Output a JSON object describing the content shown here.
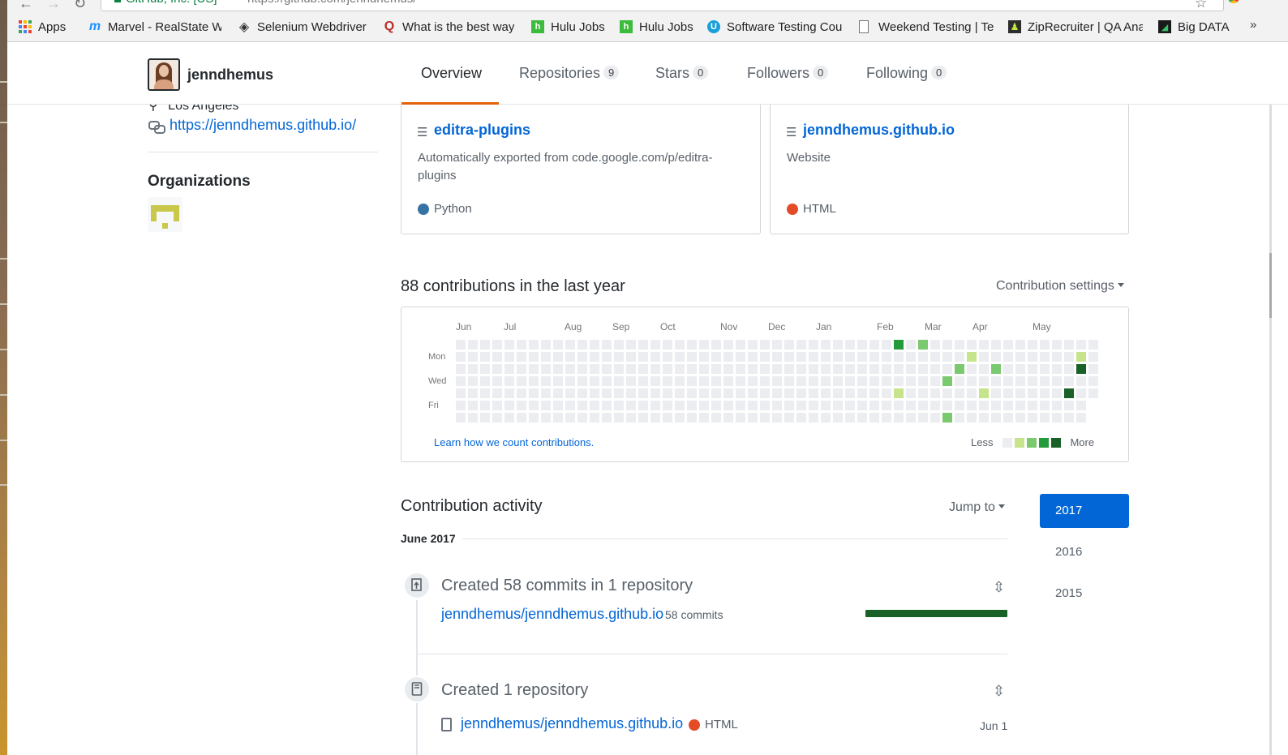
{
  "browser": {
    "site_label": "GitHub, Inc. [US]",
    "url": "https://github.com/jenndhemus/"
  },
  "bookmarks": [
    {
      "label": "Apps",
      "icon": "apps-grid-icon"
    },
    {
      "label": "Marvel - RealState W",
      "icon": "marvel-icon"
    },
    {
      "label": "Selenium Webdriver",
      "icon": "selenium-icon"
    },
    {
      "label": "What is the best way",
      "icon": "quora-icon"
    },
    {
      "label": "Hulu Jobs",
      "icon": "hulu-icon"
    },
    {
      "label": "Hulu Jobs",
      "icon": "hulu-icon"
    },
    {
      "label": "Software Testing Cou",
      "icon": "utest-icon"
    },
    {
      "label": "Weekend Testing | Te",
      "icon": "page-icon"
    },
    {
      "label": "ZipRecruiter | QA Ana",
      "icon": "ziprecruiter-icon"
    },
    {
      "label": "Big DATA",
      "icon": "bigdata-icon"
    }
  ],
  "bookmarks_overflow": "»",
  "profile": {
    "username": "jenndhemus",
    "location": "Los Angeles",
    "website": "https://jenndhemus.github.io/",
    "organizations_title": "Organizations"
  },
  "tabs": [
    {
      "label": "Overview",
      "count": null,
      "selected": true
    },
    {
      "label": "Repositories",
      "count": "9"
    },
    {
      "label": "Stars",
      "count": "0"
    },
    {
      "label": "Followers",
      "count": "0"
    },
    {
      "label": "Following",
      "count": "0"
    }
  ],
  "pinned_repos": [
    {
      "name": "editra-plugins",
      "description": "Automatically exported from code.google.com/p/editra-plugins",
      "language": "Python",
      "language_color": "#3572A5"
    },
    {
      "name": "jenndhemus.github.io",
      "description": "Website",
      "language": "HTML",
      "language_color": "#e34c26"
    }
  ],
  "contributions": {
    "title": "88 contributions in the last year",
    "settings_label": "Contribution settings",
    "months": [
      "Jun",
      "Jul",
      "Aug",
      "Sep",
      "Oct",
      "Nov",
      "Dec",
      "Jan",
      "Feb",
      "Mar",
      "Apr",
      "May"
    ],
    "weekdays": [
      "Mon",
      "Wed",
      "Fri"
    ],
    "learn_link": "Learn how we count contributions.",
    "legend_less": "Less",
    "legend_more": "More",
    "level_colors": [
      "#ebedf0",
      "#c6e48b",
      "#7bc96f",
      "#239a3b",
      "#196127"
    ],
    "active_cells": [
      {
        "week": 36,
        "day": 0,
        "level": 3
      },
      {
        "week": 38,
        "day": 0,
        "level": 2
      },
      {
        "week": 40,
        "day": 3,
        "level": 2
      },
      {
        "week": 40,
        "day": 6,
        "level": 2
      },
      {
        "week": 41,
        "day": 2,
        "level": 2
      },
      {
        "week": 36,
        "day": 4,
        "level": 1
      },
      {
        "week": 42,
        "day": 1,
        "level": 1
      },
      {
        "week": 43,
        "day": 4,
        "level": 1
      },
      {
        "week": 44,
        "day": 2,
        "level": 2
      },
      {
        "week": 51,
        "day": 1,
        "level": 1
      },
      {
        "week": 51,
        "day": 2,
        "level": 4
      },
      {
        "week": 50,
        "day": 4,
        "level": 4
      }
    ]
  },
  "activity": {
    "title": "Contribution activity",
    "jump_to": "Jump to",
    "month_heading": "June 2017",
    "years": [
      "2017",
      "2016",
      "2015"
    ],
    "selected_year": "2017",
    "items": [
      {
        "heading": "Created 58 commits in 1 repository",
        "repo": "jenndhemus/jenndhemus.github.io",
        "commits": "58 commits",
        "icon": "repo-push-icon"
      },
      {
        "heading": "Created 1 repository",
        "repo": "jenndhemus/jenndhemus.github.io",
        "language": "HTML",
        "language_color": "#e34c26",
        "date": "Jun 1",
        "icon": "repo-icon"
      }
    ]
  }
}
